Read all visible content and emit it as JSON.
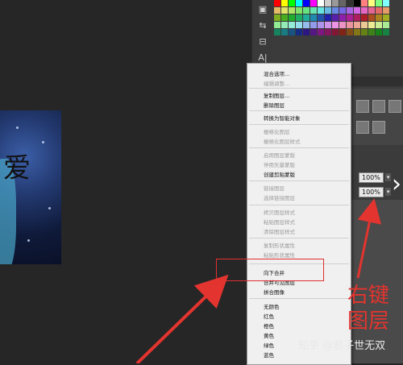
{
  "menu": {
    "items": [
      {
        "label": "混合选项...",
        "enabled": true
      },
      {
        "label": "编辑调整...",
        "enabled": false
      },
      {
        "label": "复制图层...",
        "enabled": true
      },
      {
        "label": "删除图层",
        "enabled": true
      },
      {
        "label": "转换为智能对象",
        "enabled": true
      },
      {
        "label": "栅格化图层",
        "enabled": false
      },
      {
        "label": "栅格化图层样式",
        "enabled": false
      },
      {
        "label": "启用图层蒙版",
        "enabled": false
      },
      {
        "label": "停用矢量蒙版",
        "enabled": false
      },
      {
        "label": "创建剪贴蒙版",
        "enabled": true
      },
      {
        "label": "链接图层",
        "enabled": false
      },
      {
        "label": "选择链接图层",
        "enabled": false
      },
      {
        "label": "拷贝图层样式",
        "enabled": false
      },
      {
        "label": "粘贴图层样式",
        "enabled": false
      },
      {
        "label": "清除图层样式",
        "enabled": false
      },
      {
        "label": "复制形状属性",
        "enabled": false
      },
      {
        "label": "粘贴形状属性",
        "enabled": false
      },
      {
        "label": "向下合并",
        "enabled": true
      },
      {
        "label": "合并可见图层",
        "enabled": true
      },
      {
        "label": "拼合图像",
        "enabled": true
      },
      {
        "label": "无颜色",
        "enabled": true
      },
      {
        "label": "红色",
        "enabled": true
      },
      {
        "label": "橙色",
        "enabled": true
      },
      {
        "label": "黄色",
        "enabled": true
      },
      {
        "label": "绿色",
        "enabled": true
      },
      {
        "label": "蓝色",
        "enabled": true
      }
    ]
  },
  "layers_panel": {
    "opacity_value": "100%",
    "fill_value": "100%"
  },
  "canvas": {
    "image_text": "爱"
  },
  "annotation": {
    "line1": "右键",
    "line2": "图层",
    "color": "#e3342f"
  },
  "watermark": "知乎 @君子世无双"
}
